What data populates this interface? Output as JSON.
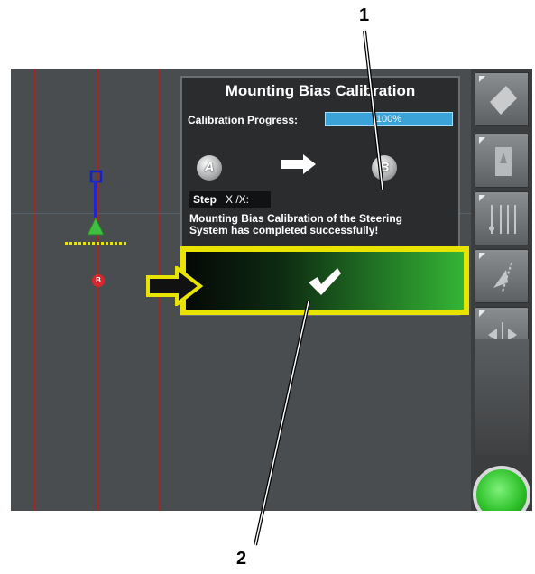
{
  "callouts": {
    "one": "1",
    "two": "2"
  },
  "dialog": {
    "title": "Mounting Bias Calibration",
    "progress_label": "Calibration Progress:",
    "progress_value": "100%",
    "progress_fraction": 1.0,
    "point_a": "A",
    "point_b": "B",
    "step_label": "Step",
    "step_value": "X /X:",
    "message": "Mounting Bias Calibration of the Steering\nSystem has completed successfully!"
  },
  "map": {
    "marker_b": "B"
  },
  "colors": {
    "confirm_border": "#e8e400",
    "confirm_gradient_end": "#34b535",
    "progress_fill": "#3ba3d8",
    "field_line": "#9a2a2a"
  },
  "icons": {
    "rail": [
      "panel-layer-icon",
      "map-view-icon",
      "guidance-lines-icon",
      "steering-calibration-icon",
      "nudge-icon"
    ],
    "confirm": "checkmark-icon",
    "start": "start-button-icon"
  }
}
